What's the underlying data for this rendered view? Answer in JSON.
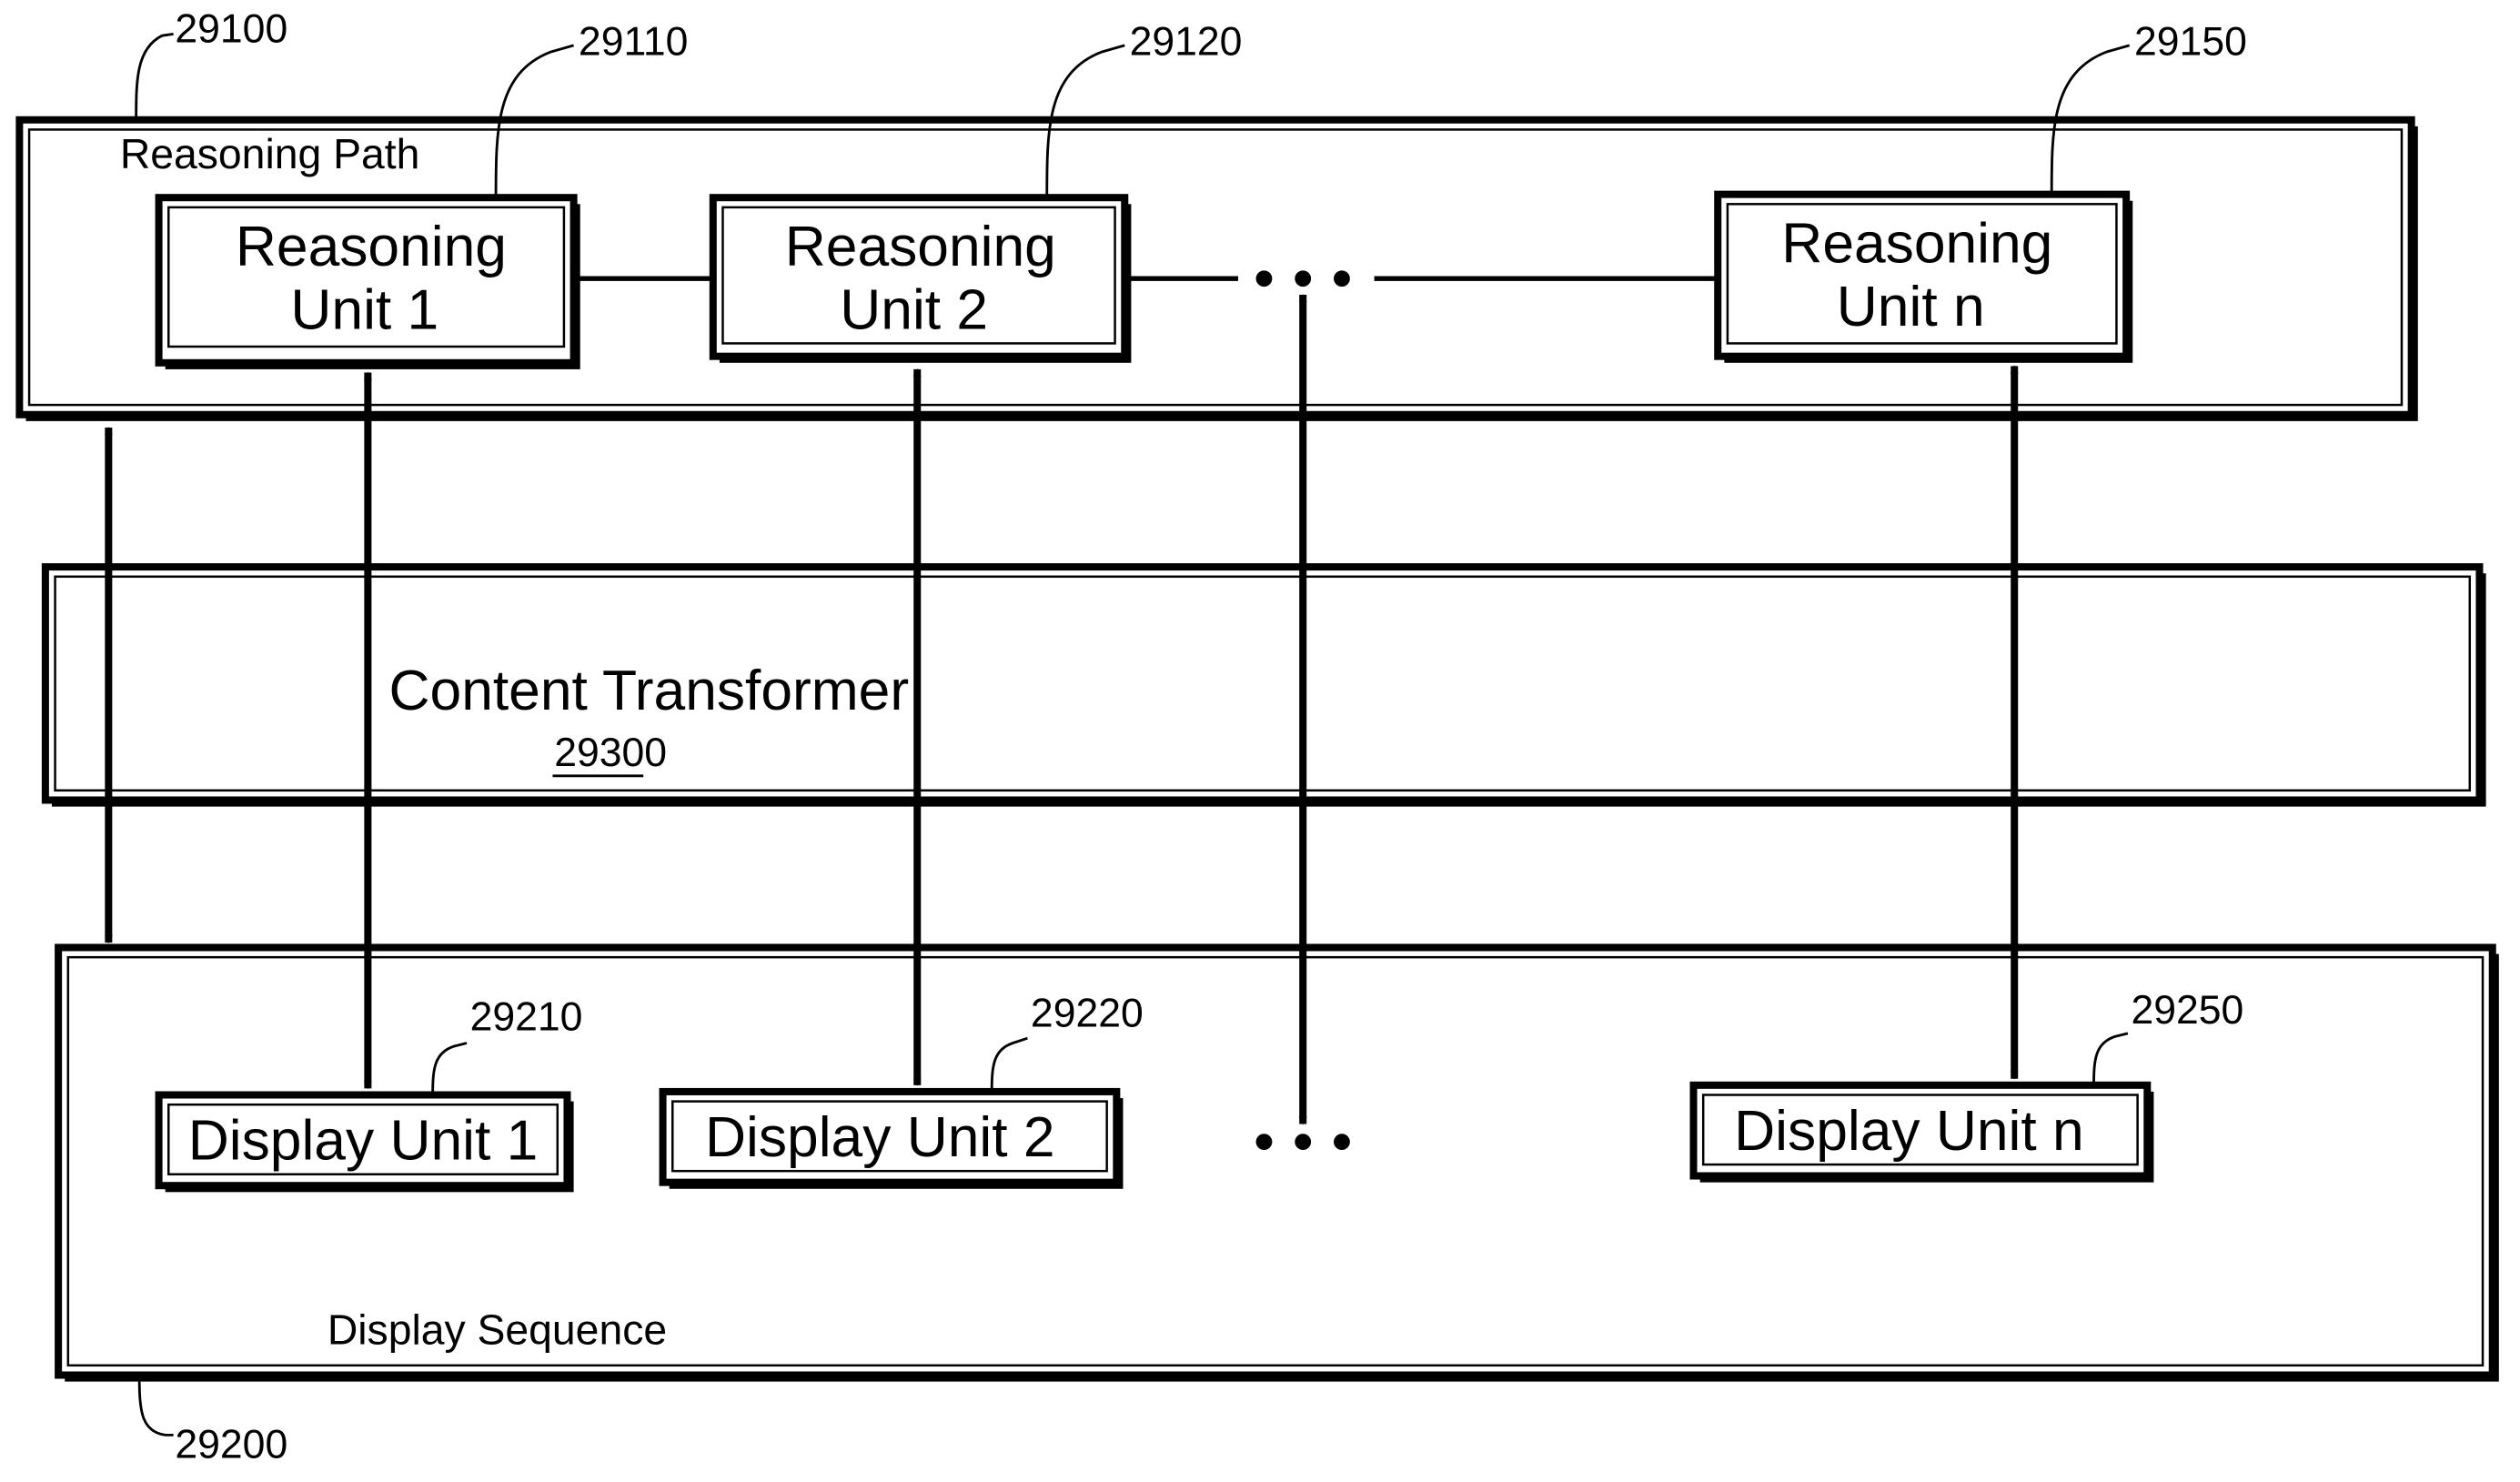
{
  "reasoning_path": {
    "label": "Reasoning Path",
    "ref": "29100",
    "units": [
      {
        "line1": "Reasoning",
        "line2": "Unit 1",
        "ref": "29110"
      },
      {
        "line1": "Reasoning",
        "line2": "Unit 2",
        "ref": "29120"
      },
      {
        "line1": "Reasoning",
        "line2": "Unit n",
        "ref": "29150"
      }
    ],
    "ellipsis": "• • •"
  },
  "content_transformer": {
    "label": "Content Transformer",
    "ref": "29300"
  },
  "display_sequence": {
    "label": "Display Sequence",
    "ref": "29200",
    "units": [
      {
        "label": "Display Unit 1",
        "ref": "29210"
      },
      {
        "label": "Display Unit 2",
        "ref": "29220"
      },
      {
        "label": "Display Unit n",
        "ref": "29250"
      }
    ],
    "ellipsis": "• • •"
  }
}
